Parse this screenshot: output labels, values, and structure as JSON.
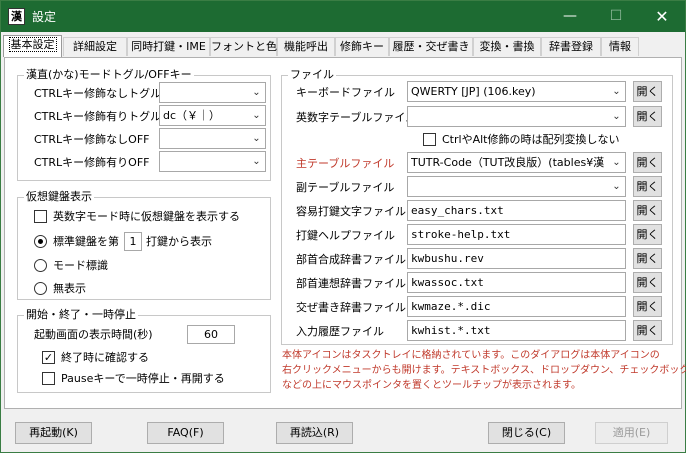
{
  "window": {
    "title": "設定",
    "icon_char": "漢",
    "minimize_glyph": "—",
    "maximize_glyph": "☐",
    "close_glyph": "✕"
  },
  "tabs": [
    {
      "label": "基本設定",
      "active": true
    },
    {
      "label": "詳細設定"
    },
    {
      "label": "同時打鍵・IME"
    },
    {
      "label": "フォントと色"
    },
    {
      "label": "機能呼出"
    },
    {
      "label": "修飾キー"
    },
    {
      "label": "履歴・交ぜ書き"
    },
    {
      "label": "変換・書換"
    },
    {
      "label": "辞書登録"
    },
    {
      "label": "情報"
    }
  ],
  "mode_toggle": {
    "title": "漢直(かな)モードトグル/OFFキー",
    "rows": [
      {
        "label": "CTRLキー修飾なしトグル",
        "value": ""
      },
      {
        "label": "CTRLキー修飾有りトグル",
        "value": "dc（￥｜）"
      },
      {
        "label": "CTRLキー修飾なしOFF",
        "value": ""
      },
      {
        "label": "CTRLキー修飾有りOFF",
        "value": ""
      }
    ]
  },
  "vkb": {
    "title": "仮想鍵盤表示",
    "alpha_mode_label": "英数字モード時に仮想鍵盤を表示する",
    "standard_prefix": "標準鍵盤を第",
    "standard_value": "1",
    "standard_suffix": "打鍵から表示",
    "mode_label": "モード標識",
    "hidden_label": "無表示"
  },
  "startup": {
    "title": "開始・終了・一時停止",
    "display_time_label": "起動画面の表示時間(秒)",
    "display_time_value": "60",
    "confirm_exit_label": "終了時に確認する",
    "confirm_exit_checked": "✓",
    "pause_key_label": "Pauseキーで一時停止・再開する"
  },
  "files": {
    "title": "ファイル",
    "open_label": "開く",
    "keyboard": {
      "label": "キーボードファイル",
      "value": "QWERTY [JP] (106.key)"
    },
    "alnum_table": {
      "label": "英数字テーブルファイル",
      "value": ""
    },
    "ctrl_alt_label": "CtrlやAlt修飾の時は配列変換しない",
    "main_table": {
      "label": "主テーブルファイル",
      "value": "TUTR-Code（TUT改良版）(tables¥漢"
    },
    "sub_table": {
      "label": "副テーブルファイル",
      "value": ""
    },
    "easy_chars": {
      "label": "容易打鍵文字ファイル",
      "value": "easy_chars.txt"
    },
    "stroke_help": {
      "label": "打鍵ヘルプファイル",
      "value": "stroke-help.txt"
    },
    "bushu_comp": {
      "label": "部首合成辞書ファイル",
      "value": "kwbushu.rev"
    },
    "bushu_assoc": {
      "label": "部首連想辞書ファイル",
      "value": "kwassoc.txt"
    },
    "mazegaki": {
      "label": "交ぜ書き辞書ファイル",
      "value": "kwmaze.*.dic"
    },
    "history": {
      "label": "入力履歴ファイル",
      "value": "kwhist.*.txt"
    }
  },
  "note": [
    "本体アイコンはタスクトレイに格納されています。このダイアログは本体アイコンの",
    "右クリックメニューからも開けます。テキストボックス、ドロップダウン、チェックボックス",
    "などの上にマウスポインタを置くとツールチップが表示されます。"
  ],
  "buttons": {
    "restart": "再起動(K)",
    "faq": "FAQ(F)",
    "reload": "再読込(R)",
    "close": "閉じる(C)",
    "apply": "適用(E)"
  },
  "colors": {
    "titlebar": "#1d6b32",
    "highlight_label": "#c0392b",
    "note_text": "#c0392b"
  }
}
